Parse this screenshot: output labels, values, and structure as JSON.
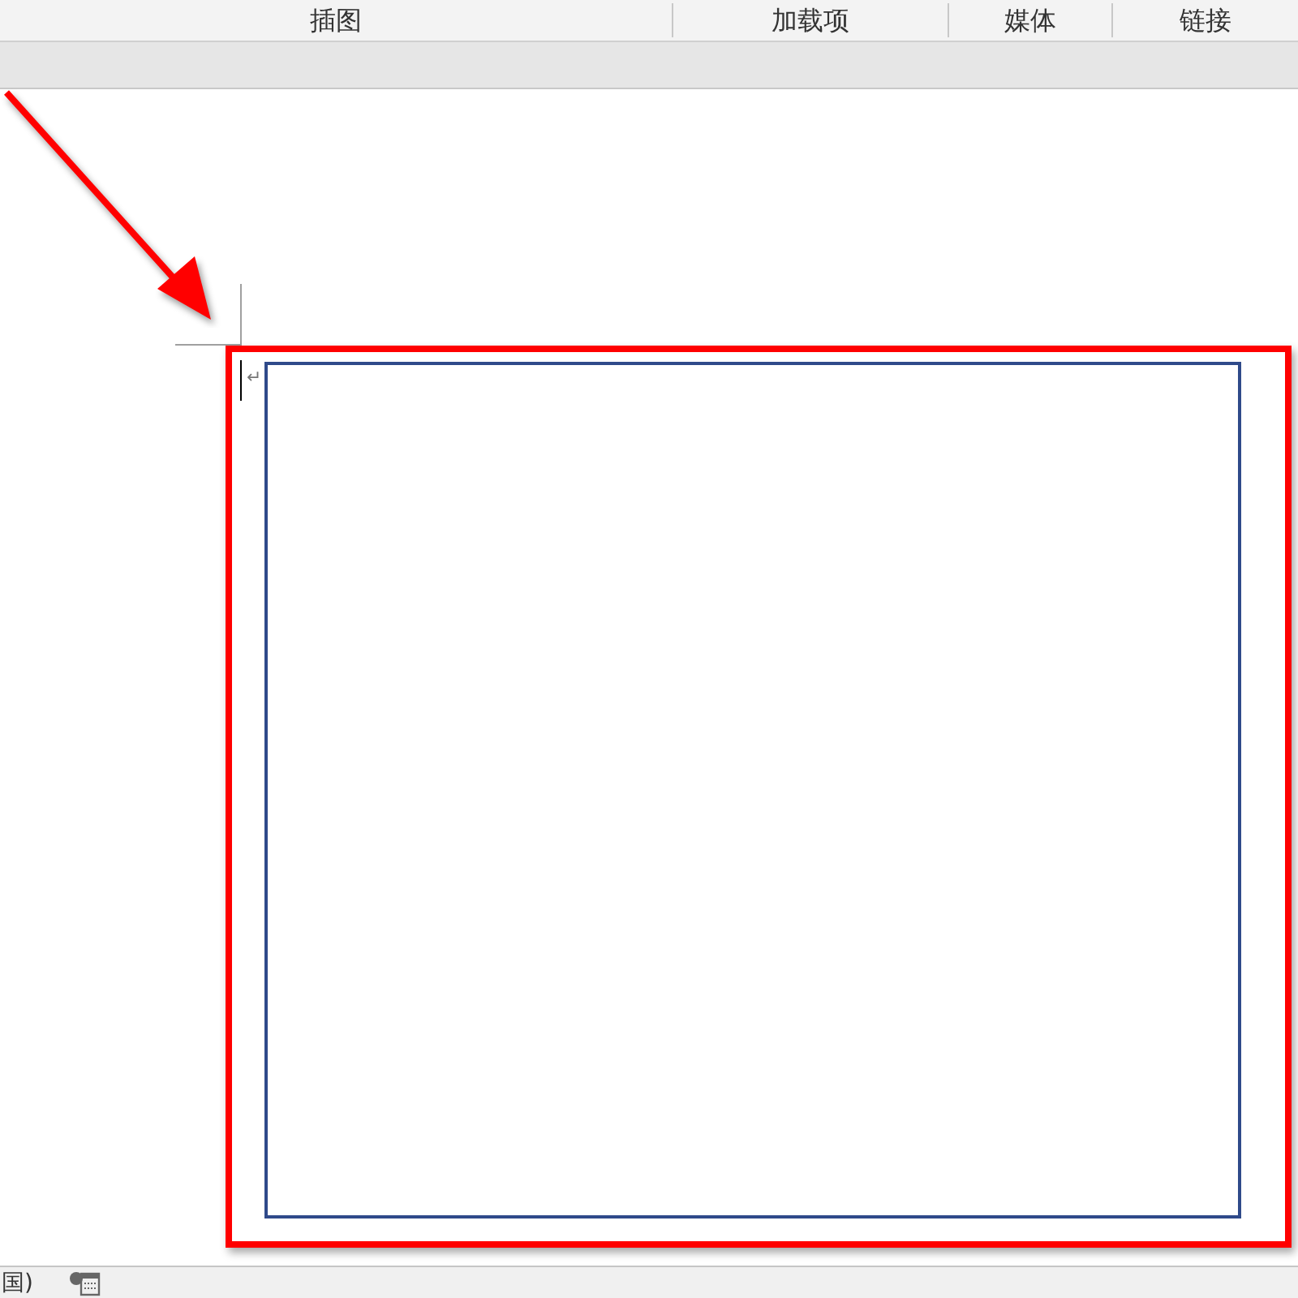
{
  "ribbon_groups": [
    "插图",
    "加载项",
    "媒体",
    "链接"
  ],
  "document": {
    "paragraph_mark": "↵",
    "frame": {
      "kind": "text-box"
    }
  },
  "status_bar": {
    "language": "国)"
  }
}
